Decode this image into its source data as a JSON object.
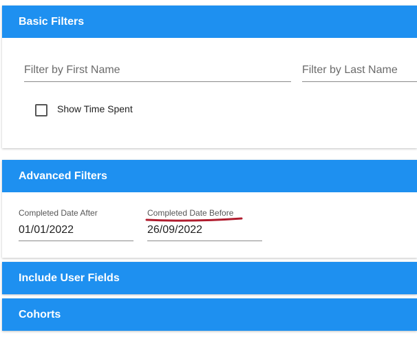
{
  "basic_filters": {
    "title": "Basic Filters",
    "first_name_placeholder": "Filter by First Name",
    "last_name_placeholder": "Filter by Last Name",
    "show_time_spent_label": "Show Time Spent",
    "show_time_spent_checked": false
  },
  "advanced_filters": {
    "title": "Advanced Filters",
    "completed_after_label": "Completed Date After",
    "completed_after_value": "01/01/2022",
    "completed_before_label": "Completed Date Before",
    "completed_before_value": "26/09/2022"
  },
  "include_user_fields": {
    "title": "Include User Fields"
  },
  "cohorts": {
    "title": "Cohorts"
  },
  "colors": {
    "header_blue": "#1e90f0",
    "annotation_red": "#b01c2e"
  }
}
